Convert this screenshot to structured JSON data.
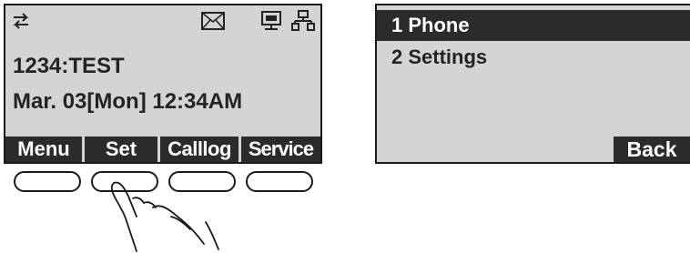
{
  "phone_screen": {
    "status_icons": [
      "transfer-arrows-icon",
      "envelope-icon",
      "display-icon",
      "network-icon"
    ],
    "extension_line": "1234:TEST",
    "date_line": "Mar. 03[Mon] 12:34AM",
    "softkeys": {
      "menu": "Menu",
      "set": "Set",
      "calllog": "Calllog",
      "service": "Service"
    }
  },
  "menu_screen": {
    "items": [
      {
        "label": "1 Phone",
        "selected": true
      },
      {
        "label": "2 Settings",
        "selected": false
      }
    ],
    "back_label": "Back"
  },
  "hand_pointer": {
    "pressed_softkey": "Set"
  }
}
